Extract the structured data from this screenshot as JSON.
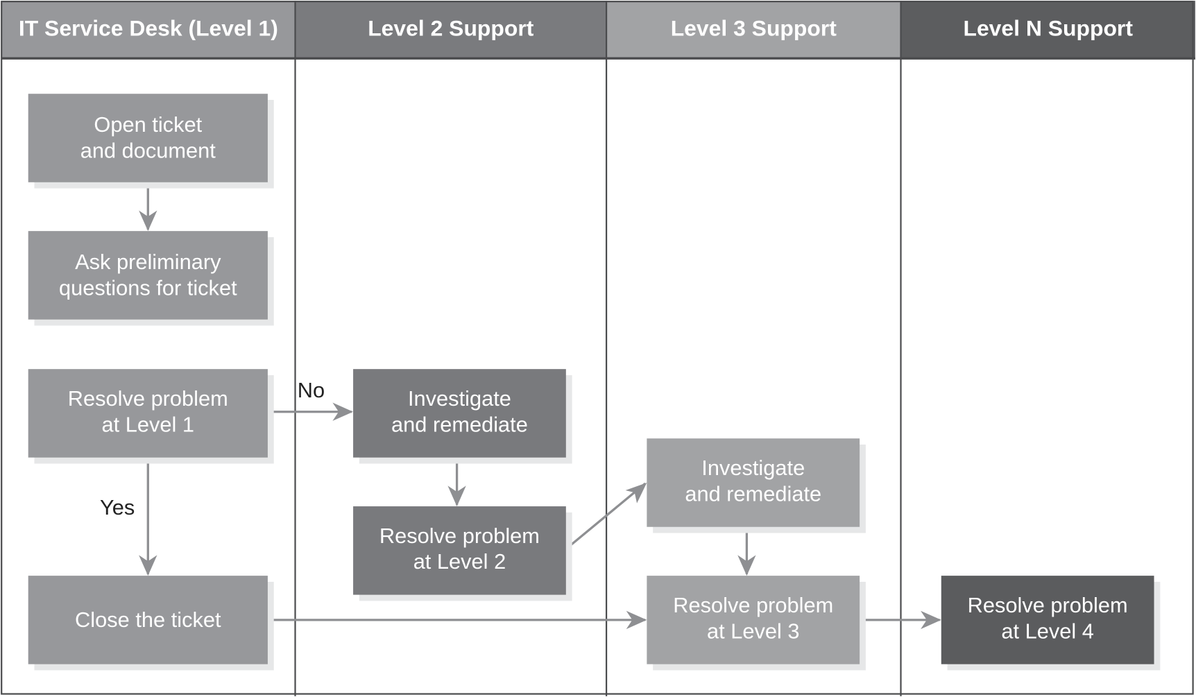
{
  "lanes": [
    {
      "title": "IT Service Desk (Level 1)",
      "color": "#97989b"
    },
    {
      "title": "Level 2 Support",
      "color": "#7a7b7e"
    },
    {
      "title": "Level 3 Support",
      "color": "#a2a3a5"
    },
    {
      "title": "Level N Support",
      "color": "#5c5d5f"
    }
  ],
  "nodes": {
    "open_ticket": {
      "line1": "Open ticket",
      "line2": "and document"
    },
    "ask_questions": {
      "line1": "Ask preliminary",
      "line2": "questions for ticket"
    },
    "resolve_l1": {
      "line1": "Resolve problem",
      "line2": "at Level 1"
    },
    "close_ticket": {
      "line1": "Close the ticket"
    },
    "investigate_l2": {
      "line1": "Investigate",
      "line2": "and remediate"
    },
    "resolve_l2": {
      "line1": "Resolve problem",
      "line2": "at Level 2"
    },
    "investigate_l3": {
      "line1": "Investigate",
      "line2": "and remediate"
    },
    "resolve_l3": {
      "line1": "Resolve problem",
      "line2": "at Level 3"
    },
    "resolve_l4": {
      "line1": "Resolve problem",
      "line2": "at Level 4"
    }
  },
  "edge_labels": {
    "no": "No",
    "yes": "Yes"
  },
  "colors": {
    "arrow": "#8e8f92",
    "border": "#4a4b4d",
    "shadow": "#e6e7e8"
  }
}
